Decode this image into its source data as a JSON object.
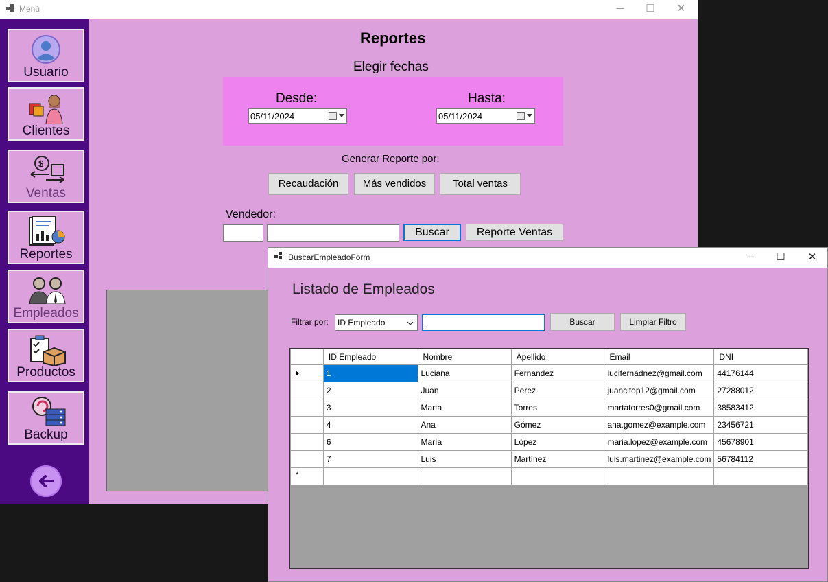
{
  "main_window": {
    "title": "Menú",
    "controls": {
      "minimize": "─",
      "maximize": "☐",
      "close": "✕"
    }
  },
  "sidebar": {
    "items": [
      {
        "label": "Usuario"
      },
      {
        "label": "Clientes"
      },
      {
        "label": "Ventas"
      },
      {
        "label": "Reportes"
      },
      {
        "label": "Empleados"
      },
      {
        "label": "Productos"
      },
      {
        "label": "Backup"
      }
    ]
  },
  "reportes": {
    "title": "Reportes",
    "subtitle": "Elegir fechas",
    "desde_label": "Desde:",
    "desde_value": "05/11/2024",
    "hasta_label": "Hasta:",
    "hasta_value": "05/11/2024",
    "generar_label": "Generar Reporte por:",
    "buttons": {
      "recaudacion": "Recaudación",
      "mas_vendidos": "Más vendidos",
      "total_ventas": "Total ventas"
    },
    "vendedor_label": "Vendedor:",
    "vendedor_id": "",
    "vendedor_nombre": "",
    "buscar": "Buscar",
    "reporte_ventas": "Reporte Ventas"
  },
  "dialog": {
    "title": "BuscarEmpleadoForm",
    "heading": "Listado de Empleados",
    "filter_label": "Filtrar por:",
    "filter_selected": "ID Empleado",
    "search_value": "",
    "buscar": "Buscar",
    "limpiar": "Limpiar Filtro",
    "columns": [
      "ID Empleado",
      "Nombre",
      "Apellido",
      "Email",
      "DNI"
    ],
    "rows": [
      [
        "1",
        "Luciana",
        "Fernandez",
        "lucifernadnez@gmail.com",
        "44176144"
      ],
      [
        "2",
        "Juan",
        "Perez",
        "juancitop12@gmail.com",
        "27288012"
      ],
      [
        "3",
        "Marta",
        "Torres",
        "martatorres0@gmail.com",
        "38583412"
      ],
      [
        "4",
        "Ana",
        "Gómez",
        "ana.gomez@example.com",
        "23456721"
      ],
      [
        "6",
        "María",
        "López",
        "maria.lopez@example.com",
        "45678901"
      ],
      [
        "7",
        "Luis",
        "Martínez",
        "luis.martinez@example.com",
        "56784112"
      ]
    ],
    "selected_row": 0
  },
  "colors": {
    "accent": "#dca0dc",
    "sidebar": "#4b0a82",
    "date_panel": "#ee82ee",
    "selection": "#0078d7"
  }
}
